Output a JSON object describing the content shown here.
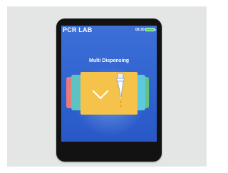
{
  "device": {
    "title": "PCR LAB",
    "time": "09:30",
    "battery_icon": "battery-full-icon",
    "mode_label": "Multi Dispensing"
  },
  "icons": {
    "selected_mode_icon": "chevron-down-icon",
    "mode_icon": "pipette-tip-icon"
  },
  "colors": {
    "screen": "#2f63cf",
    "selected_card": "#f6c34a",
    "battery": "#4fd35a"
  }
}
